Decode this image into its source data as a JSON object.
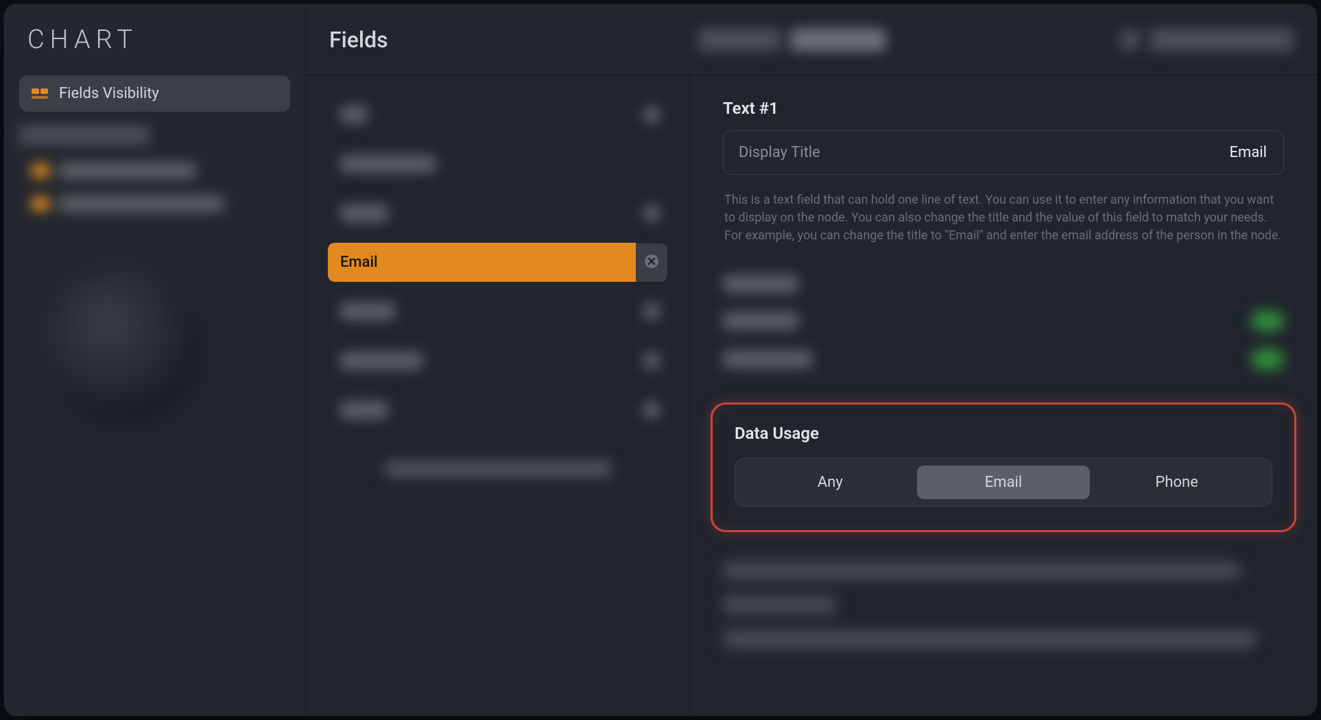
{
  "sidebar": {
    "title": "CHART",
    "items": [
      {
        "label": "Fields Visibility",
        "selected": true
      }
    ]
  },
  "header": {
    "title": "Fields"
  },
  "field_list": {
    "selected": {
      "label": "Email"
    }
  },
  "detail": {
    "section_title": "Text #1",
    "display_title_label": "Display Title",
    "display_title_value": "Email",
    "description": "This is a text field that can hold one line of text. You can use it to enter any information that you want to display on the node. You can also change the title and the value of this field to match your needs. For example, you can change the title to \"Email\" and enter the email address of the person in the node.",
    "data_usage": {
      "heading": "Data Usage",
      "options": [
        "Any",
        "Email",
        "Phone"
      ],
      "selected_index": 1
    }
  }
}
